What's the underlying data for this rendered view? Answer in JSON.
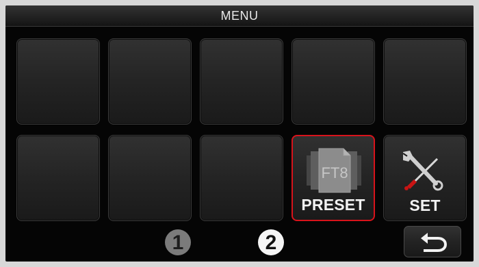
{
  "header": {
    "title": "MENU"
  },
  "tiles": [
    {
      "label": ""
    },
    {
      "label": ""
    },
    {
      "label": ""
    },
    {
      "label": ""
    },
    {
      "label": ""
    },
    {
      "label": ""
    },
    {
      "label": ""
    },
    {
      "label": ""
    },
    {
      "label": "PRESET",
      "icon": "ft8-preset-icon",
      "icon_text": "FT8",
      "highlighted": true
    },
    {
      "label": "SET",
      "icon": "wrench-screwdriver-icon"
    }
  ],
  "pager": {
    "pages": [
      "1",
      "2"
    ],
    "active": "2"
  },
  "footer": {
    "back_icon": "return-arrow-icon"
  },
  "colors": {
    "highlight_border": "#d8131b",
    "screen_background": "#050505",
    "active_page": "#f5f5f5",
    "inactive_page": "#7b7b7b"
  }
}
